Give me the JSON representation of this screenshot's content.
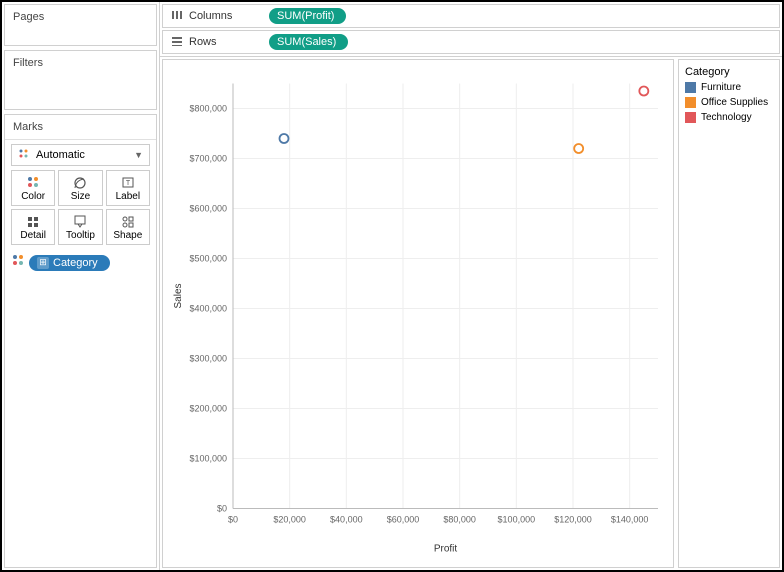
{
  "panels": {
    "pages_title": "Pages",
    "filters_title": "Filters",
    "marks_title": "Marks"
  },
  "marks": {
    "dropdown_label": "Automatic",
    "cards": {
      "color": "Color",
      "size": "Size",
      "label": "Label",
      "detail": "Detail",
      "tooltip": "Tooltip",
      "shape": "Shape"
    },
    "pill_label": "Category"
  },
  "shelves": {
    "columns_label": "Columns",
    "rows_label": "Rows",
    "columns_pill": "SUM(Profit)",
    "rows_pill": "SUM(Sales)"
  },
  "legend": {
    "title": "Category",
    "items": [
      {
        "label": "Furniture",
        "color": "#4e79a7"
      },
      {
        "label": "Office Supplies",
        "color": "#f28e2b"
      },
      {
        "label": "Technology",
        "color": "#e15759"
      }
    ]
  },
  "axes": {
    "xlabel": "Profit",
    "ylabel": "Sales",
    "xticks": [
      "$0",
      "$20,000",
      "$40,000",
      "$60,000",
      "$80,000",
      "$100,000",
      "$120,000",
      "$140,000"
    ],
    "yticks": [
      "$0",
      "$100,000",
      "$200,000",
      "$300,000",
      "$400,000",
      "$500,000",
      "$600,000",
      "$700,000",
      "$800,000"
    ]
  },
  "chart_data": {
    "type": "scatter",
    "xlabel": "Profit",
    "ylabel": "Sales",
    "xlim": [
      0,
      150000
    ],
    "ylim": [
      0,
      850000
    ],
    "series": [
      {
        "name": "Furniture",
        "color": "#4e79a7",
        "x": [
          18000
        ],
        "y": [
          740000
        ]
      },
      {
        "name": "Office Supplies",
        "color": "#f28e2b",
        "x": [
          122000
        ],
        "y": [
          720000
        ]
      },
      {
        "name": "Technology",
        "color": "#e15759",
        "x": [
          145000
        ],
        "y": [
          835000
        ]
      }
    ]
  }
}
